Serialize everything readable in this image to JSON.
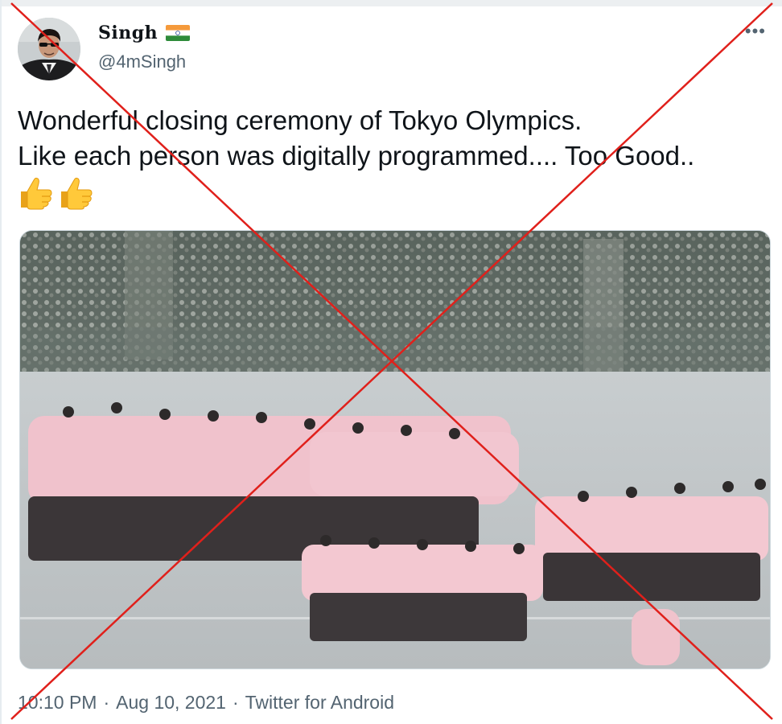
{
  "author": {
    "display_name": "Singh",
    "flag_icon": "india-flag-icon",
    "handle": "@4mSingh"
  },
  "more_icon": "more-options-icon",
  "tweet": {
    "line1": "Wonderful closing ceremony of Tokyo Olympics.",
    "line2": "Like each person was digitally programmed.... Too Good..",
    "emojis": [
      "thumbs-up-icon",
      "thumbs-up-icon"
    ]
  },
  "media": {
    "type": "video",
    "icon": "video-thumbnail-icon"
  },
  "meta": {
    "time": "10:10 PM",
    "separator1": "·",
    "date": "Aug 10, 2021",
    "separator2": "·",
    "source": "Twitter for Android"
  },
  "overlay": {
    "icon": "red-cross-mark-icon",
    "color": "#e0201b"
  },
  "colors": {
    "text": "#0f1419",
    "secondary": "#536471",
    "border": "#cfd9de"
  }
}
